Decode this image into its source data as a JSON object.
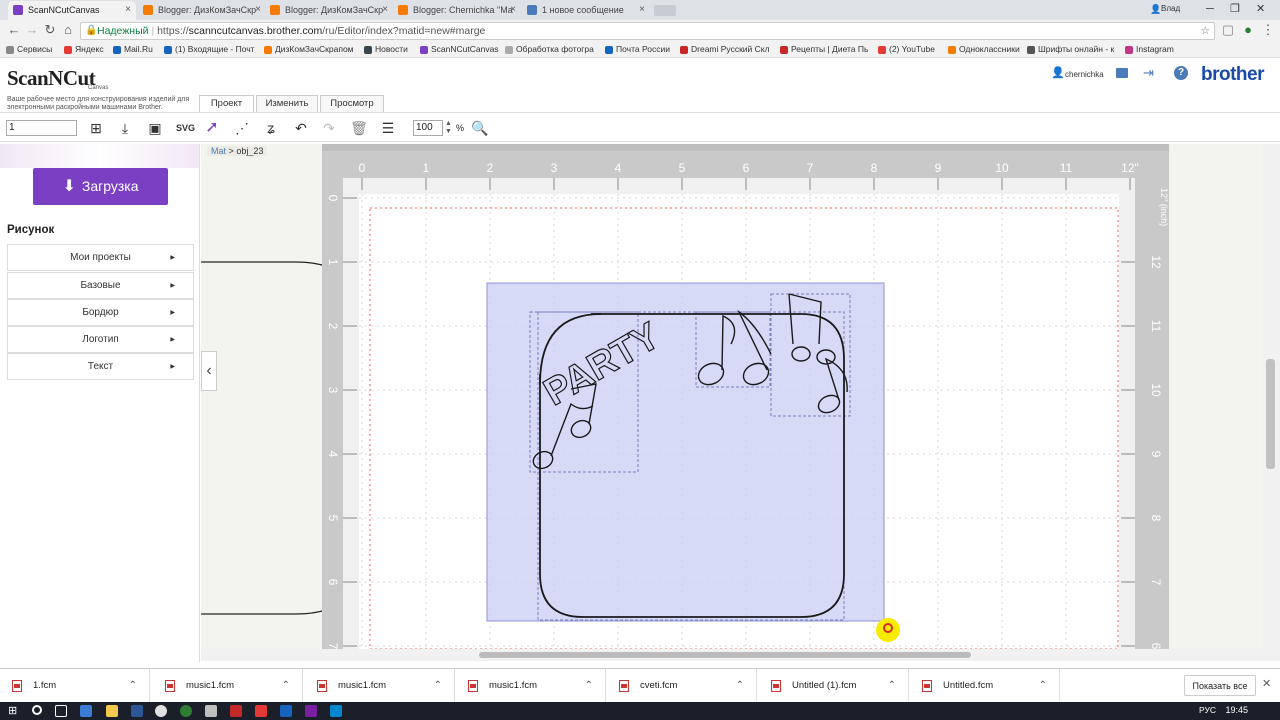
{
  "browser": {
    "tabs": [
      {
        "label": "ScanNCutCanvas",
        "active": true,
        "favicon_color": "#7b3fc4"
      },
      {
        "label": "Blogger: ДизКомЗачСкр",
        "active": false,
        "favicon_color": "#f57c00"
      },
      {
        "label": "Blogger: ДизКомЗачСкр",
        "active": false,
        "favicon_color": "#f57c00"
      },
      {
        "label": "Blogger: Chernichka \"Ma",
        "active": false,
        "favicon_color": "#f57c00"
      },
      {
        "label": "1 новое сообщение",
        "active": false,
        "favicon_color": "#4a7ab8"
      }
    ],
    "user": "Влад",
    "secure_label": "Надежный",
    "url_scheme": "https://",
    "url_host": "scanncutcanvas.brother.com",
    "url_path": "/ru/Editor/index?matid=new#marge",
    "bookmarks": [
      {
        "label": "Сервисы",
        "color": "#888"
      },
      {
        "label": "Яндекс",
        "color": "#e53935"
      },
      {
        "label": "Mail.Ru",
        "color": "#1565c0"
      },
      {
        "label": "(1) Входящие - Почт",
        "color": "#1565c0"
      },
      {
        "label": "ДизКомЗачСкрапом",
        "color": "#f57c00"
      },
      {
        "label": "Новости",
        "color": "#37474f"
      },
      {
        "label": "ScanNCutCanvas",
        "color": "#7b3fc4"
      },
      {
        "label": "Обработка фотогра",
        "color": "#aaa"
      },
      {
        "label": "Почта России",
        "color": "#1565c0"
      },
      {
        "label": "Dreami Русский Скл",
        "color": "#c62828"
      },
      {
        "label": "Рецепты | Диета Пь",
        "color": "#c62828"
      },
      {
        "label": "(2) YouTube",
        "color": "#e53935"
      },
      {
        "label": "Одноклассники",
        "color": "#f57c00"
      },
      {
        "label": "Шрифты онлайн - к",
        "color": "#555"
      },
      {
        "label": "Instagram",
        "color": "#c13584"
      }
    ]
  },
  "app": {
    "logo": "ScanNCut",
    "logo_sub": "Canvas",
    "tagline": "Ваше рабочее место для конструирования изделий для электронными раскройными машинами Brother.",
    "main_tabs": [
      "Проект",
      "Изменить",
      "Просмотр"
    ],
    "username": "chernichka",
    "brand": "brother"
  },
  "toolbar": {
    "page_value": "1",
    "zoom_value": "100",
    "zoom_unit": "%"
  },
  "sidebar": {
    "upload_label": "Загрузка",
    "section_title": "Рисунок",
    "items": [
      "Мои проекты",
      "Базовые",
      "Бордюр",
      "Логотип",
      "Текст"
    ]
  },
  "canvas": {
    "breadcrumb_root": "Mat",
    "breadcrumb_sep": ">",
    "breadcrumb_obj": "obj_23",
    "ruler_unit_label": "12\" (inch)",
    "top_inch_ticks": [
      "0",
      "1",
      "2",
      "3",
      "4",
      "5",
      "6",
      "7",
      "8",
      "9",
      "10",
      "11",
      "12\""
    ],
    "left_inch_ticks": [
      "0",
      "1",
      "2",
      "3",
      "4",
      "5",
      "6",
      "7"
    ],
    "right_inch_ticks": [
      "12",
      "11",
      "10",
      "9",
      "8",
      "7",
      "6",
      "5"
    ],
    "cut_text": "PARTY"
  },
  "downloads": {
    "files": [
      "1.fcm",
      "music1.fcm",
      "music1.fcm",
      "music1.fcm",
      "cveti.fcm",
      "Untitled (1).fcm",
      "Untitled.fcm"
    ],
    "show_all": "Показать все"
  },
  "taskbar": {
    "lang": "РУС",
    "time": "19:45"
  }
}
